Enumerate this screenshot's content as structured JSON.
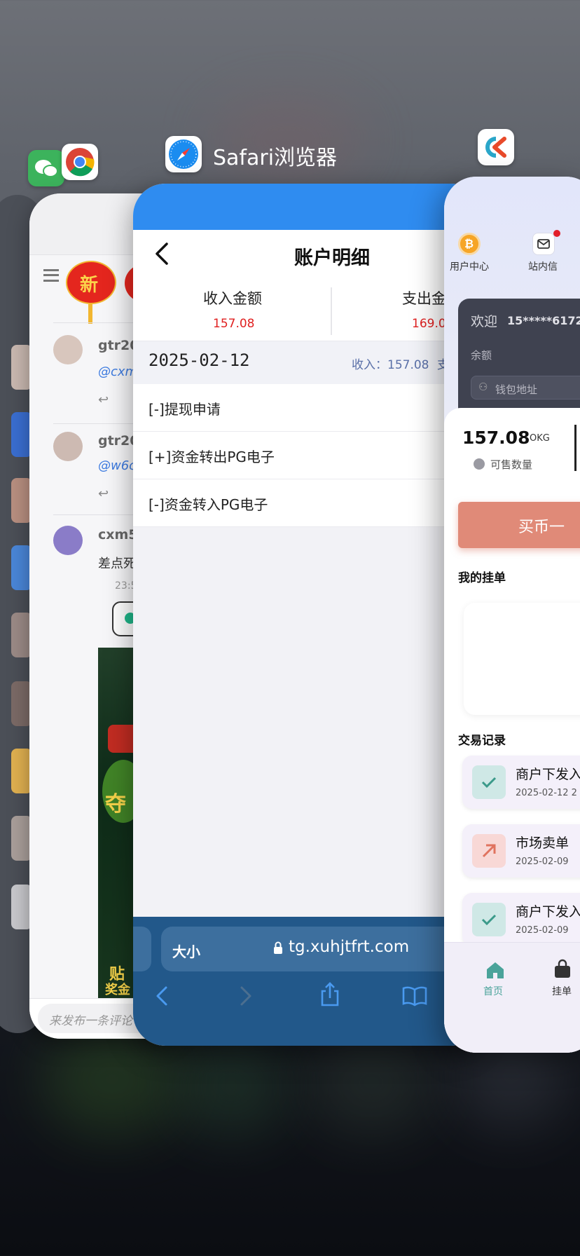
{
  "switcher": {
    "safari_label": "Safari浏览器",
    "wechat_icon": "wechat-icon",
    "chrome_icon": "chrome-icon",
    "safari_icon": "safari-icon",
    "ok_icon_text": "OK"
  },
  "comments_card": {
    "lantern_text": "新",
    "comments": [
      {
        "user": "gtr20",
        "mention": "@cxm"
      },
      {
        "user": "gtr20",
        "mention": "@w6c"
      },
      {
        "user": "cxm5",
        "text": "差点死",
        "time": "23:5"
      }
    ],
    "banner_text_1": "夺",
    "banner_text_2": "贴",
    "banner_text_3": "奖金",
    "input_placeholder": "来发布一条评论"
  },
  "safari": {
    "title": "账户明细",
    "summary": {
      "income_label": "收入金额",
      "income_value": "157.08",
      "expense_label": "支出金",
      "expense_value": "169.0"
    },
    "date": "2025-02-12",
    "date_income": "收入：157.08",
    "date_expense_abbr": "支",
    "rows": [
      "[-]提现申请",
      "[+]资金转出PG电子",
      "[-]资金转入PG电子"
    ],
    "url_size_label": "大小",
    "url": "tg.xuhjtfrt.com",
    "colors": {
      "accent": "#2f8cf0",
      "toolbar": "#22588a",
      "amount": "#e02020"
    }
  },
  "ok_app": {
    "nav": {
      "user_center": "用户中心",
      "inbox": "站内信"
    },
    "welcome": "欢迎",
    "phone": "15*****6172",
    "balance_label": "余额",
    "wallet_label": "钱包地址",
    "amount": "157.08",
    "unit": "OKG",
    "sellable": "可售数量",
    "buy_button": "买币一",
    "my_orders": "我的挂单",
    "trade_records": "交易记录",
    "records": [
      {
        "title": "商户下发入",
        "date": "2025-02-12 2",
        "type": "check"
      },
      {
        "title": "市场卖单",
        "date": "2025-02-09",
        "type": "arrow"
      },
      {
        "title": "商户下发入",
        "date": "2025-02-09",
        "type": "check"
      }
    ],
    "tabs": {
      "home": "首页",
      "orders": "挂单"
    }
  }
}
